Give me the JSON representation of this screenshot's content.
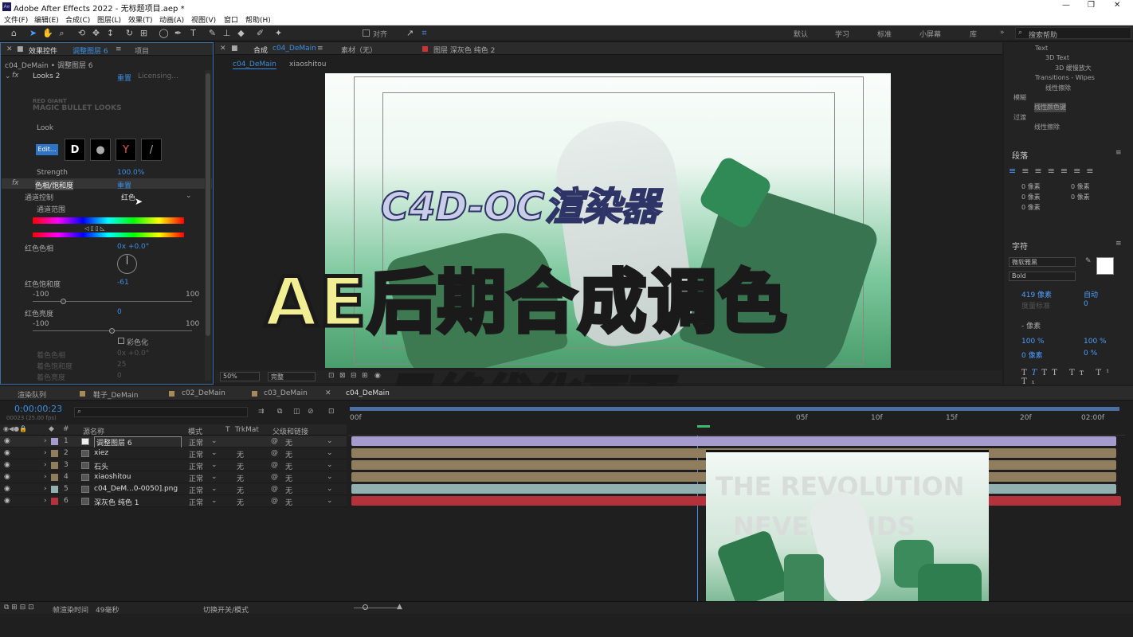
{
  "window": {
    "title": "Adobe After Effects 2022 - 无标题项目.aep *",
    "controls": [
      "—",
      "❐",
      "✕"
    ]
  },
  "menu": [
    "文件(F)",
    "编辑(E)",
    "合成(C)",
    "图层(L)",
    "效果(T)",
    "动画(A)",
    "视图(V)",
    "窗口",
    "帮助(H)"
  ],
  "toolbar": {
    "align_label": "对齐",
    "workspaces": [
      "默认",
      "学习",
      "标准",
      "小屏幕",
      "库"
    ],
    "search_placeholder": "搜索帮助"
  },
  "effects_panel": {
    "tab": "效果控件",
    "tab_layer": "调整图层 6",
    "tab2": "项目",
    "breadcrumb": "c04_DeMain • 调整图层 6",
    "looks": {
      "name": "Looks 2",
      "reset": "重置",
      "licensing": "Licensing...",
      "brand1": "RED GIANT",
      "brand2": "MAGIC BULLET LOOKS",
      "look_label": "Look",
      "edit_btn": "Edit...",
      "strength_label": "Strength",
      "strength_value": "100.0%"
    },
    "hue": {
      "name": "色相/饱和度",
      "reset": "重置",
      "channel_label": "通道控制",
      "channel_value": "红色",
      "range_label": "通道范围",
      "red_hue_label": "红色色相",
      "red_hue_value": "0x +0.0°",
      "red_sat_label": "红色饱和度",
      "red_sat_value": "-61",
      "red_sat_min": "-100",
      "red_sat_max": "100",
      "red_sat_fraction": 0.195,
      "red_light_label": "红色亮度",
      "red_light_value": "0",
      "red_light_min": "-100",
      "red_light_max": "100",
      "red_light_fraction": 0.5,
      "colorize_label": "彩色化",
      "master_hue": "着色色相",
      "master_sat": "着色饱和度",
      "master_light": "着色亮度",
      "master_hue_val": "0x +0.0°",
      "master_sat_val": "25",
      "master_light_val": "0"
    }
  },
  "comp_panel": {
    "tab_comp": "合成",
    "comp_name": "c04_DeMain",
    "footage_tab": "素材（无）",
    "layer_tab": "图层 深灰色 纯色 2",
    "sub_tabs": [
      "c04_DeMain",
      "xiaoshitou"
    ],
    "canvas": {
      "logo": "C4D-OC渲染器",
      "headline": "AE后期合成调色",
      "subhead": "最终优化画面"
    },
    "zoom": "50%",
    "quality": "完整"
  },
  "right_panel": {
    "tree": [
      "Text",
      "3D Text",
      "3D 缓慢放大",
      "Transitions - Wipes",
      "线性擦除",
      "模糊",
      "线性颜色键",
      "过渡",
      "线性擦除"
    ],
    "paragraph_title": "段落",
    "para_values": [
      "0 像素",
      "0 像素",
      "0 像素",
      "0 像素",
      "0 像素"
    ],
    "char_title": "字符",
    "font": "微软雅黑",
    "style": "Bold",
    "font_size": "419 像素",
    "leading": "自动",
    "tracking_label": "度量标准",
    "tracking": "0",
    "stroke": "- 像素",
    "v_scale": "100 %",
    "h_scale": "100 %",
    "baseline": "0 像素",
    "tsume": "0 %"
  },
  "timeline": {
    "tabs": [
      "渲染队列",
      "鞋子_DeMain",
      "c02_DeMain",
      "c03_DeMain",
      "c04_DeMain"
    ],
    "timecode": "0:00:00:23",
    "fps": "00023 (25.00 fps)",
    "columns": {
      "name": "源名称",
      "mode": "模式",
      "t": "T",
      "trkmat": "TrkMat",
      "parent": "父级和链接"
    },
    "layers": [
      {
        "num": "1",
        "name": "调整图层 6",
        "mode": "正常",
        "trk": "",
        "parent": "无",
        "color": "#a59bcc"
      },
      {
        "num": "2",
        "name": "xiez",
        "mode": "正常",
        "trk": "无",
        "parent": "无",
        "color": "#8f7d5d"
      },
      {
        "num": "3",
        "name": "石头",
        "mode": "正常",
        "trk": "无",
        "parent": "无",
        "color": "#8f7d5d"
      },
      {
        "num": "4",
        "name": "xiaoshitou",
        "mode": "正常",
        "trk": "无",
        "parent": "无",
        "color": "#8f7d5d"
      },
      {
        "num": "5",
        "name": "c04_DeM...0-0050].png",
        "mode": "正常",
        "trk": "无",
        "parent": "无",
        "color": "#92b0b0"
      },
      {
        "num": "6",
        "name": "深灰色 纯色 1",
        "mode": "正常",
        "trk": "无",
        "parent": "无",
        "color": "#b3323c"
      }
    ],
    "ruler": [
      "00f",
      "05f",
      "10f",
      "15f",
      "20f",
      "02:00f"
    ],
    "footer_render": "帧渲染时间",
    "footer_ms": "49毫秒",
    "footer_toggle": "切换开关/模式",
    "preview_text1": "THE  REVOLUTION",
    "preview_text2": "NEVER ENDS"
  }
}
